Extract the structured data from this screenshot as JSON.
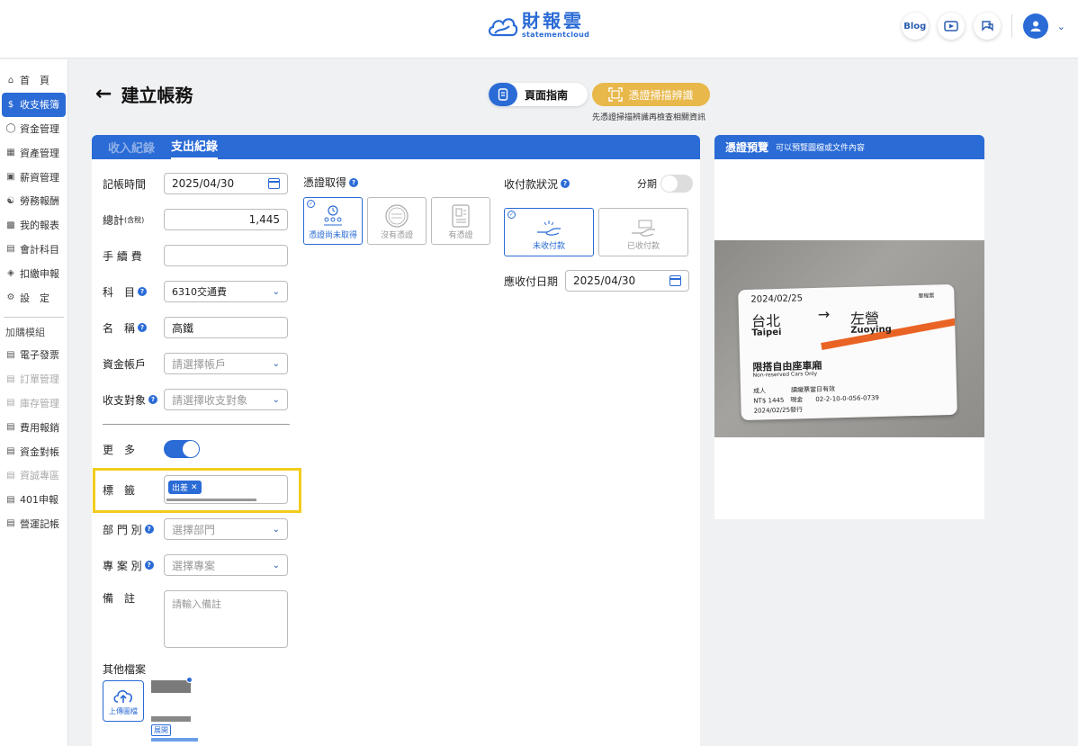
{
  "brand": {
    "name_cn": "財報雲",
    "name_en": "statementcloud"
  },
  "topbar": {
    "blog": "Blog"
  },
  "sidebar": {
    "items": [
      {
        "label": "首　頁",
        "icon": "home-icon",
        "state": "normal"
      },
      {
        "label": "收支帳簿",
        "icon": "dollar-icon",
        "state": "active"
      },
      {
        "label": "資金管理",
        "icon": "coins-icon",
        "state": "normal"
      },
      {
        "label": "資產管理",
        "icon": "building-icon",
        "state": "normal"
      },
      {
        "label": "薪資管理",
        "icon": "wallet-icon",
        "state": "normal"
      },
      {
        "label": "勞務報酬",
        "icon": "handshake-icon",
        "state": "normal"
      },
      {
        "label": "我的報表",
        "icon": "chart-icon",
        "state": "normal"
      },
      {
        "label": "會計科目",
        "icon": "ledger-icon",
        "state": "normal"
      },
      {
        "label": "扣繳申報",
        "icon": "tax-icon",
        "state": "normal"
      },
      {
        "label": "設　定",
        "icon": "settings-icon",
        "state": "normal"
      }
    ],
    "section_label": "加購模組",
    "modules": [
      {
        "label": "電子發票",
        "state": "normal"
      },
      {
        "label": "訂單管理",
        "state": "disabled"
      },
      {
        "label": "庫存管理",
        "state": "disabled"
      },
      {
        "label": "費用報銷",
        "state": "normal"
      },
      {
        "label": "資金對帳",
        "state": "normal"
      },
      {
        "label": "資誠專區",
        "state": "disabled"
      },
      {
        "label": "401申報",
        "state": "normal"
      },
      {
        "label": "營運記帳",
        "state": "normal"
      }
    ]
  },
  "header": {
    "title": "建立帳務",
    "guide_label": "頁面指南",
    "scan_label": "憑證掃描辨識",
    "scan_hint": "先憑證掃描辨識再檢查相關資訊"
  },
  "tabs": {
    "income": "收入紀錄",
    "expense": "支出紀錄"
  },
  "form": {
    "date_label": "記帳時間",
    "date_value": "2025/04/30",
    "total_label": "總計",
    "total_suffix": "(含稅)",
    "total_value": "1,445",
    "fee_label": "手 續 費",
    "fee_value": "",
    "subject_label": "科　目",
    "subject_value": "6310交通費",
    "name_label": "名　稱",
    "name_value": "高鐵",
    "account_label": "資金帳戶",
    "account_placeholder": "請選擇帳戶",
    "party_label": "收支對象",
    "party_placeholder": "請選擇收支對象",
    "more_label": "更　多",
    "tag_label": "標　籤",
    "tag_chip": "出差",
    "dept_label": "部 門 別",
    "dept_placeholder": "選擇部門",
    "project_label": "專 案 別",
    "project_placeholder": "選擇專案",
    "note_label": "備　註",
    "note_placeholder": "請輸入備註",
    "other_files_label": "其他檔案",
    "upload_label": "上傳圖檔",
    "expand_label": "展開"
  },
  "voucher": {
    "label": "憑證取得",
    "options": [
      "憑證尚未取得",
      "沒有憑證",
      "有憑證"
    ],
    "selected": 0
  },
  "payment": {
    "label": "收付款狀況",
    "installment_label": "分期",
    "options": [
      "未收付款",
      "已收付款"
    ],
    "selected": 0,
    "due_label": "應收付日期",
    "due_value": "2025/04/30"
  },
  "preview": {
    "title": "憑證預覽",
    "subtitle": "可以預覽圖檔或文件內容",
    "ticket": {
      "date": "2024/02/25",
      "tag": "單程票",
      "from_cn": "台北",
      "from_en": "Taipei",
      "arrow": "→",
      "to_cn": "左營",
      "to_en": "Zuoying",
      "seat_cn": "限搭自由座車廂",
      "seat_en": "Non-reserved Cars Only",
      "line1": "成人　　　　讀繳票當日有效",
      "line2": "NT$ 1445　現金　　02-2-10-0-056-0739",
      "line3": "2024/02/25發行"
    }
  },
  "colors": {
    "primary": "#2a6bd6",
    "scan": "#e8b84b",
    "highlight": "#f2cc1c",
    "ticket_stripe": "#e96424"
  }
}
